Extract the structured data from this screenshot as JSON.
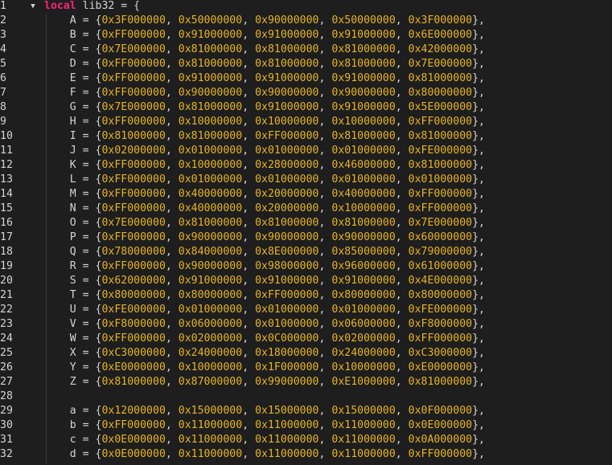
{
  "editor": {
    "fold_glyph": "▼",
    "keyword": "local",
    "declaration": " lib32 = {",
    "rows": [
      {
        "ln": "1",
        "kind": "decl"
      },
      {
        "ln": "2",
        "name": "A",
        "vals": [
          "0x3F000000",
          "0x50000000",
          "0x90000000",
          "0x50000000",
          "0x3F000000"
        ]
      },
      {
        "ln": "3",
        "name": "B",
        "vals": [
          "0xFF000000",
          "0x91000000",
          "0x91000000",
          "0x91000000",
          "0x6E000000"
        ]
      },
      {
        "ln": "4",
        "name": "C",
        "vals": [
          "0x7E000000",
          "0x81000000",
          "0x81000000",
          "0x81000000",
          "0x42000000"
        ]
      },
      {
        "ln": "5",
        "name": "D",
        "vals": [
          "0xFF000000",
          "0x81000000",
          "0x81000000",
          "0x81000000",
          "0x7E000000"
        ]
      },
      {
        "ln": "6",
        "name": "E",
        "vals": [
          "0xFF000000",
          "0x91000000",
          "0x91000000",
          "0x91000000",
          "0x81000000"
        ]
      },
      {
        "ln": "7",
        "name": "F",
        "vals": [
          "0xFF000000",
          "0x90000000",
          "0x90000000",
          "0x90000000",
          "0x80000000"
        ]
      },
      {
        "ln": "8",
        "name": "G",
        "vals": [
          "0x7E000000",
          "0x81000000",
          "0x91000000",
          "0x91000000",
          "0x5E000000"
        ]
      },
      {
        "ln": "9",
        "name": "H",
        "vals": [
          "0xFF000000",
          "0x10000000",
          "0x10000000",
          "0x10000000",
          "0xFF000000"
        ]
      },
      {
        "ln": "10",
        "name": "I",
        "vals": [
          "0x81000000",
          "0x81000000",
          "0xFF000000",
          "0x81000000",
          "0x81000000"
        ]
      },
      {
        "ln": "11",
        "name": "J",
        "vals": [
          "0x02000000",
          "0x01000000",
          "0x01000000",
          "0x01000000",
          "0xFE000000"
        ]
      },
      {
        "ln": "12",
        "name": "K",
        "vals": [
          "0xFF000000",
          "0x10000000",
          "0x28000000",
          "0x46000000",
          "0x81000000"
        ]
      },
      {
        "ln": "13",
        "name": "L",
        "vals": [
          "0xFF000000",
          "0x01000000",
          "0x01000000",
          "0x01000000",
          "0x01000000"
        ]
      },
      {
        "ln": "14",
        "name": "M",
        "vals": [
          "0xFF000000",
          "0x40000000",
          "0x20000000",
          "0x40000000",
          "0xFF000000"
        ]
      },
      {
        "ln": "15",
        "name": "N",
        "vals": [
          "0xFF000000",
          "0x40000000",
          "0x20000000",
          "0x10000000",
          "0xFF000000"
        ]
      },
      {
        "ln": "16",
        "name": "O",
        "vals": [
          "0x7E000000",
          "0x81000000",
          "0x81000000",
          "0x81000000",
          "0x7E000000"
        ]
      },
      {
        "ln": "17",
        "name": "P",
        "vals": [
          "0xFF000000",
          "0x90000000",
          "0x90000000",
          "0x90000000",
          "0x60000000"
        ]
      },
      {
        "ln": "18",
        "name": "Q",
        "vals": [
          "0x78000000",
          "0x84000000",
          "0x8E000000",
          "0x85000000",
          "0x79000000"
        ]
      },
      {
        "ln": "19",
        "name": "R",
        "vals": [
          "0xFF000000",
          "0x90000000",
          "0x98000000",
          "0x96000000",
          "0x61000000"
        ]
      },
      {
        "ln": "20",
        "name": "S",
        "vals": [
          "0x62000000",
          "0x91000000",
          "0x91000000",
          "0x91000000",
          "0x4E000000"
        ]
      },
      {
        "ln": "21",
        "name": "T",
        "vals": [
          "0x80000000",
          "0x80000000",
          "0xFF000000",
          "0x80000000",
          "0x80000000"
        ]
      },
      {
        "ln": "22",
        "name": "U",
        "vals": [
          "0xFE000000",
          "0x01000000",
          "0x01000000",
          "0x01000000",
          "0xFE000000"
        ]
      },
      {
        "ln": "23",
        "name": "V",
        "vals": [
          "0xF8000000",
          "0x06000000",
          "0x01000000",
          "0x06000000",
          "0xF8000000"
        ]
      },
      {
        "ln": "24",
        "name": "W",
        "vals": [
          "0xFF000000",
          "0x02000000",
          "0x0C000000",
          "0x02000000",
          "0xFF000000"
        ]
      },
      {
        "ln": "25",
        "name": "X",
        "vals": [
          "0xC3000000",
          "0x24000000",
          "0x18000000",
          "0x24000000",
          "0xC3000000"
        ]
      },
      {
        "ln": "26",
        "name": "Y",
        "vals": [
          "0xE0000000",
          "0x10000000",
          "0x1F000000",
          "0x10000000",
          "0xE0000000"
        ]
      },
      {
        "ln": "27",
        "name": "Z",
        "vals": [
          "0x81000000",
          "0x87000000",
          "0x99000000",
          "0xE1000000",
          "0x81000000"
        ]
      },
      {
        "ln": "28",
        "kind": "blank"
      },
      {
        "ln": "29",
        "name": "a",
        "vals": [
          "0x12000000",
          "0x15000000",
          "0x15000000",
          "0x15000000",
          "0x0F000000"
        ]
      },
      {
        "ln": "30",
        "name": "b",
        "vals": [
          "0xFF000000",
          "0x11000000",
          "0x11000000",
          "0x11000000",
          "0x0E000000"
        ]
      },
      {
        "ln": "31",
        "name": "c",
        "vals": [
          "0x0E000000",
          "0x11000000",
          "0x11000000",
          "0x11000000",
          "0x0A000000"
        ]
      },
      {
        "ln": "32",
        "name": "d",
        "vals": [
          "0x0E000000",
          "0x11000000",
          "0x11000000",
          "0x11000000",
          "0xFF000000"
        ]
      }
    ],
    "colors": {
      "background": "#1e1e1e",
      "keyword": "#f92672",
      "hex_literal": "#e6b422",
      "plain_text": "#d4d4d4",
      "indent_guide": "#3a3a3a"
    }
  }
}
